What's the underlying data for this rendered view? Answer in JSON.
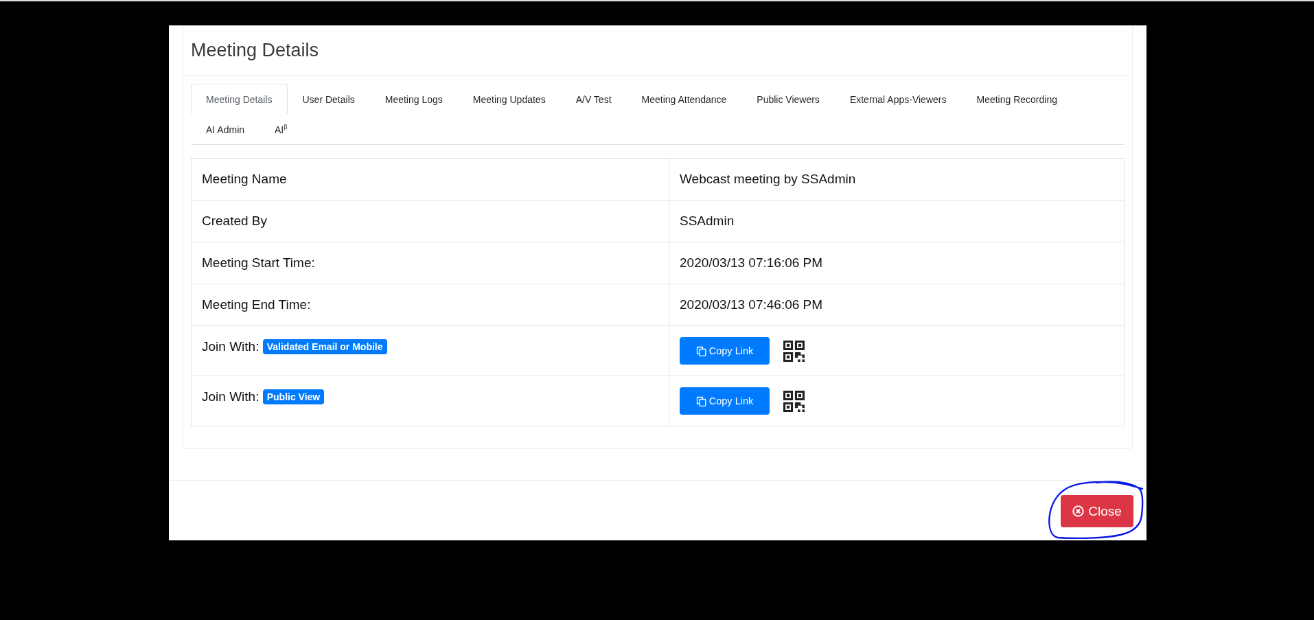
{
  "modal": {
    "title": "Meeting Details"
  },
  "tabs": [
    {
      "label": "Meeting Details",
      "selected": true
    },
    {
      "label": "User Details",
      "selected": false
    },
    {
      "label": "Meeting Logs",
      "selected": false
    },
    {
      "label": "Meeting Updates",
      "selected": false
    },
    {
      "label": "A/V Test",
      "selected": false
    },
    {
      "label": "Meeting Attendance",
      "selected": false
    },
    {
      "label": "Public Viewers",
      "selected": false
    },
    {
      "label": "External Apps-Viewers",
      "selected": false
    },
    {
      "label": "Meeting Recording",
      "selected": false
    },
    {
      "label": "AI Admin",
      "selected": false
    },
    {
      "label": "AI$^{β}$",
      "selected": false
    }
  ],
  "details": {
    "rows": [
      {
        "kind": "text",
        "label": "Meeting Name",
        "value": "Webcast meeting by SSAdmin"
      },
      {
        "kind": "text",
        "label": "Created By",
        "value": "SSAdmin"
      },
      {
        "kind": "text",
        "label": "Meeting Start Time:",
        "value": "2020/03/13 07:16:06 PM"
      },
      {
        "kind": "text",
        "label": "Meeting End Time:",
        "value": "2020/03/13 07:46:06 PM"
      },
      {
        "kind": "join",
        "label": "Join With:",
        "badge": "Validated Email or Mobile",
        "button": "Copy Link"
      },
      {
        "kind": "join",
        "label": "Join With:",
        "badge": "Public View",
        "button": "Copy Link"
      }
    ]
  },
  "footer": {
    "close_button": {
      "label": "Close",
      "highlighted": true
    }
  }
}
